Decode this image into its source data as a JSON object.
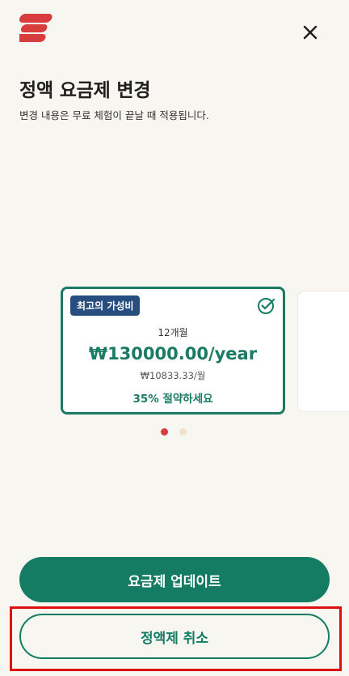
{
  "header": {
    "logo_icon": "expressvpn-logo-icon",
    "close_icon": "close-icon"
  },
  "content": {
    "title": "정액 요금제 변경",
    "subtitle": "변경 내용은 무료 체험이 끝날 때 적용됩니다."
  },
  "plan_card": {
    "badge": "최고의 가성비",
    "duration": "12개월",
    "price": "₩130000.00/year",
    "monthly_price": "₩10833.33/월",
    "savings": "35% 절약하세요",
    "selected_icon": "check-circle-icon"
  },
  "carousel": {
    "current_page": 1,
    "total_pages": 2
  },
  "buttons": {
    "update": "요금제 업데이트",
    "cancel": "정액제 취소"
  },
  "colors": {
    "accent": "#137c63",
    "badge": "#284d7f",
    "brand_red": "#d73d3d",
    "highlight": "#e00f0f"
  }
}
